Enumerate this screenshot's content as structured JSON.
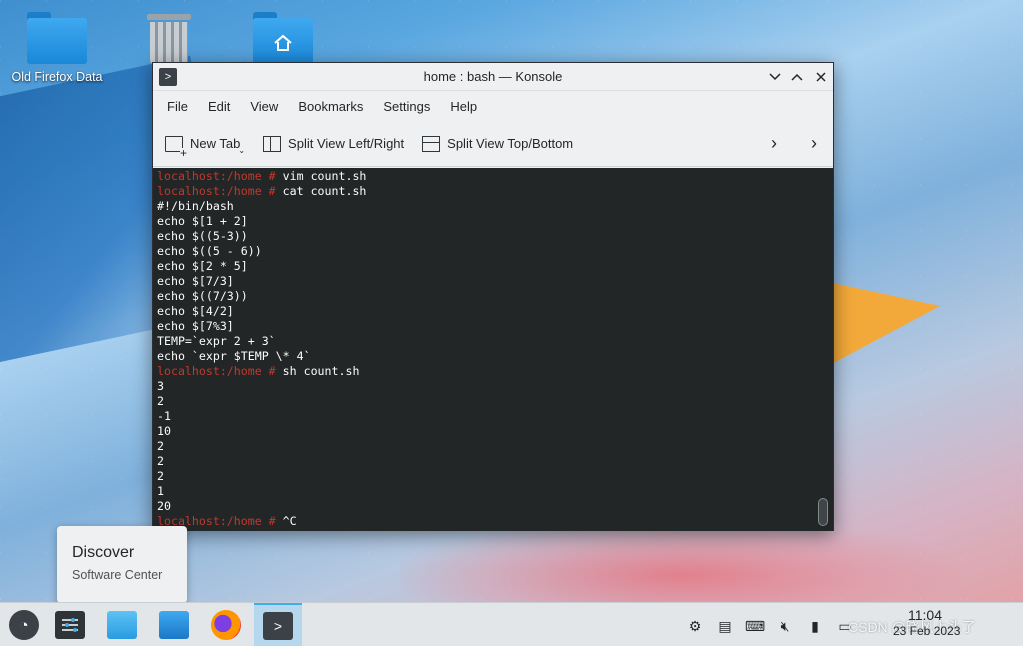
{
  "desktop": {
    "icons": [
      {
        "label": "Old Firefox Data",
        "icon": "folder-icon"
      },
      {
        "label": "",
        "icon": "trash-icon"
      },
      {
        "label": "",
        "icon": "home-folder-icon"
      }
    ]
  },
  "window": {
    "title": "home : bash — Konsole",
    "menu": [
      "File",
      "Edit",
      "View",
      "Bookmarks",
      "Settings",
      "Help"
    ],
    "toolbar": {
      "new_tab": "New Tab",
      "split_lr": "Split View Left/Right",
      "split_tb": "Split View Top/Bottom"
    },
    "terminal": {
      "prompt": "localhost:/home #",
      "lines": [
        {
          "prompt": "localhost:/home #",
          "text": " vim count.sh"
        },
        {
          "prompt": "localhost:/home #",
          "text": " cat count.sh"
        },
        {
          "prompt": "",
          "text": "#!/bin/bash"
        },
        {
          "prompt": "",
          "text": "echo $[1 + 2]"
        },
        {
          "prompt": "",
          "text": "echo $((5-3))"
        },
        {
          "prompt": "",
          "text": "echo $((5 - 6))"
        },
        {
          "prompt": "",
          "text": "echo $[2 * 5]"
        },
        {
          "prompt": "",
          "text": "echo $[7/3]"
        },
        {
          "prompt": "",
          "text": "echo $((7/3))"
        },
        {
          "prompt": "",
          "text": "echo $[4/2]"
        },
        {
          "prompt": "",
          "text": "echo $[7%3]"
        },
        {
          "prompt": "",
          "text": "TEMP=`expr 2 + 3`"
        },
        {
          "prompt": "",
          "text": "echo `expr $TEMP \\* 4`"
        },
        {
          "prompt": "localhost:/home #",
          "text": " sh count.sh"
        },
        {
          "prompt": "",
          "text": "3"
        },
        {
          "prompt": "",
          "text": "2"
        },
        {
          "prompt": "",
          "text": "-1"
        },
        {
          "prompt": "",
          "text": "10"
        },
        {
          "prompt": "",
          "text": "2"
        },
        {
          "prompt": "",
          "text": "2"
        },
        {
          "prompt": "",
          "text": "2"
        },
        {
          "prompt": "",
          "text": "1"
        },
        {
          "prompt": "",
          "text": "20"
        },
        {
          "prompt": "localhost:/home #",
          "text": " ^C"
        }
      ]
    }
  },
  "tooltip": {
    "title": "Discover",
    "subtitle": "Software Center"
  },
  "taskbar": {
    "apps": [
      "app-launcher-icon",
      "settings-icon",
      "discover-icon",
      "file-manager-icon",
      "firefox-icon",
      "konsole-icon"
    ],
    "tray": [
      "network-icon",
      "clipboard-icon",
      "keyboard-icon",
      "volume-muted-icon",
      "usb-icon",
      "printer-icon"
    ],
    "clock_time": "11:04",
    "clock_date": "23 Feb 2023",
    "watermark": "CSDN @晓风上头了"
  },
  "colors": {
    "prompt": "#c0392b",
    "terminal_bg": "#232627",
    "accent": "#3daee9"
  }
}
